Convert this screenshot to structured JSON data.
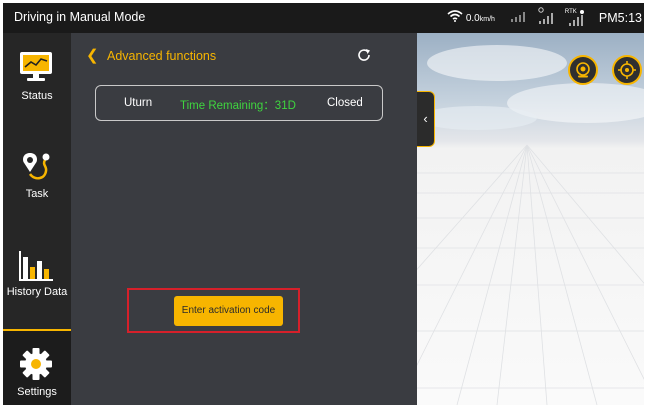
{
  "window": {
    "title": "Driving in Manual Mode"
  },
  "status_bar": {
    "speed_value": "0.0",
    "speed_unit": "km/h",
    "rtk_label": "RTK",
    "time": "PM5:13"
  },
  "sidebar": {
    "items": [
      {
        "label": "Status",
        "icon": "monitor-chart-icon"
      },
      {
        "label": "Task",
        "icon": "route-pin-icon"
      },
      {
        "label": "History Data",
        "icon": "bar-chart-icon"
      },
      {
        "label": "Settings",
        "icon": "gear-icon",
        "active": true
      }
    ]
  },
  "panel": {
    "title": "Advanced functions",
    "feature": {
      "name": "Uturn",
      "remaining": "Time Remaining：31D",
      "status": "Closed"
    },
    "activate_label": "Enter activation code"
  },
  "colors": {
    "accent": "#f7b500",
    "success": "#3fd53f",
    "highlight_border": "#d6202a",
    "panel_bg": "#3a3c41",
    "sidebar_bg": "#262626"
  }
}
